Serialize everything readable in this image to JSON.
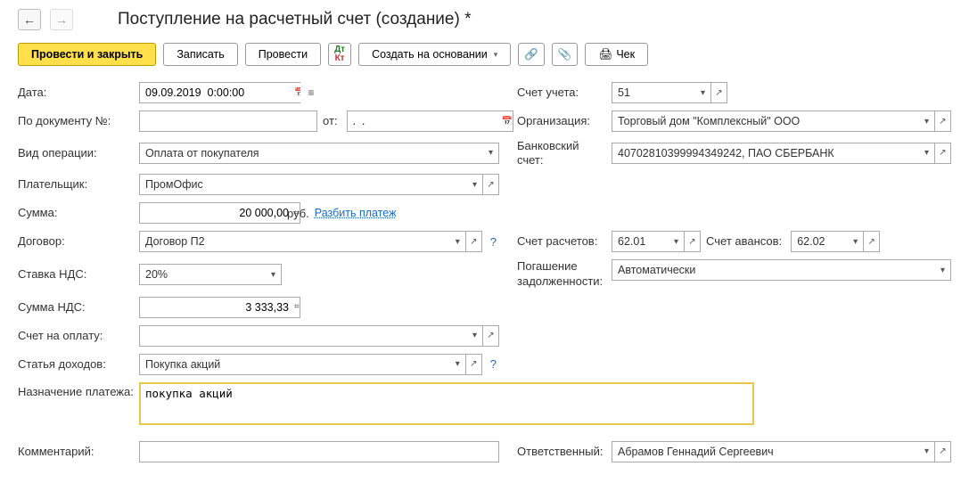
{
  "title": "Поступление на расчетный счет (создание) *",
  "toolbar": {
    "post_close": "Провести и закрыть",
    "save": "Записать",
    "post": "Провести",
    "create_based": "Создать на основании",
    "cheque": "Чек"
  },
  "left": {
    "date_label": "Дата:",
    "date_value": "09.09.2019  0:00:00",
    "docnum_label": "По документу №:",
    "docnum_value": "",
    "docnum_from": "от:",
    "docdate_value": ".  .",
    "optype_label": "Вид операции:",
    "optype_value": "Оплата от покупателя",
    "payer_label": "Плательщик:",
    "payer_value": "ПромОфис",
    "sum_label": "Сумма:",
    "sum_value": "20 000,00",
    "sum_currency": "руб.",
    "split_link": "Разбить платеж",
    "contract_label": "Договор:",
    "contract_value": "Договор П2",
    "vatrate_label": "Ставка НДС:",
    "vatrate_value": "20%",
    "vatsum_label": "Сумма НДС:",
    "vatsum_value": "3 333,33",
    "invoice_label": "Счет на оплату:",
    "invoice_value": "",
    "income_label": "Статья доходов:",
    "income_value": "Покупка акций",
    "purpose_label": "Назначение платежа:",
    "purpose_value": "покупка акций",
    "comment_label": "Комментарий:",
    "comment_value": ""
  },
  "right": {
    "account_label": "Счет учета:",
    "account_value": "51",
    "org_label": "Организация:",
    "org_value": "Торговый дом \"Комплексный\" ООО",
    "bank_label": "Банковский счет:",
    "bank_value": "40702810399994349242, ПАО СБЕРБАНК",
    "settle_label": "Счет расчетов:",
    "settle_value": "62.01",
    "advance_label": "Счет авансов:",
    "advance_value": "62.02",
    "debt_label": "Погашение задолженности:",
    "debt_value": "Автоматически",
    "responsible_label": "Ответственный:",
    "responsible_value": "Абрамов Геннадий Сергеевич"
  }
}
